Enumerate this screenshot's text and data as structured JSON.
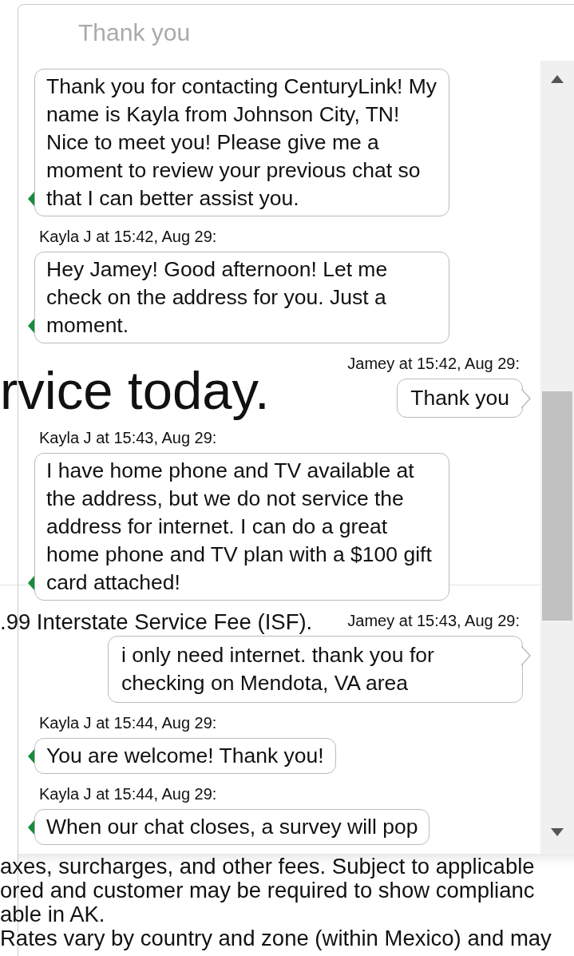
{
  "chat": {
    "header_text": "Thank you",
    "messages": [
      {
        "kind": "agent",
        "text": "Thank you for contacting CenturyLink! My name is Kayla from Johnson City, TN! Nice to meet you! Please give me a moment to review your previous chat so that I can better assist you."
      },
      {
        "kind": "agent",
        "meta": "Kayla J at 15:42, Aug 29:",
        "text": "Hey Jamey! Good afternoon!  Let me check on the address for you. Just a moment."
      },
      {
        "kind": "customer",
        "meta": "Jamey at 15:42, Aug 29:",
        "text": "Thank you"
      },
      {
        "kind": "agent",
        "meta": "Kayla J at 15:43, Aug 29:",
        "text": "I have home phone and TV available at the address, but we do not service the address for internet. I can do a great home phone and TV plan with a $100 gift card attached!"
      },
      {
        "kind": "customer",
        "meta": "Jamey at 15:43, Aug 29:",
        "text": "i only need internet. thank you for checking on Mendota, VA area"
      },
      {
        "kind": "agent",
        "meta": "Kayla J at 15:44, Aug 29:",
        "text": "You are welcome! Thank you!"
      },
      {
        "kind": "agent",
        "meta": "Kayla J at 15:44, Aug 29:",
        "text": "When our chat closes, a survey will pop"
      }
    ]
  },
  "background_page": [
    {
      "kind": "heading",
      "text": "rvice today."
    },
    {
      "kind": "line",
      "text": ".99 Interstate Service Fee (ISF)."
    },
    {
      "kind": "line",
      "text": "axes, surcharges, and other fees. Subject to applicable"
    },
    {
      "kind": "line",
      "text": "ored and customer may be required to show complianc"
    },
    {
      "kind": "line",
      "text": "able in AK."
    },
    {
      "kind": "line",
      "text": "Rates vary by country and zone (within Mexico) and may"
    }
  ]
}
